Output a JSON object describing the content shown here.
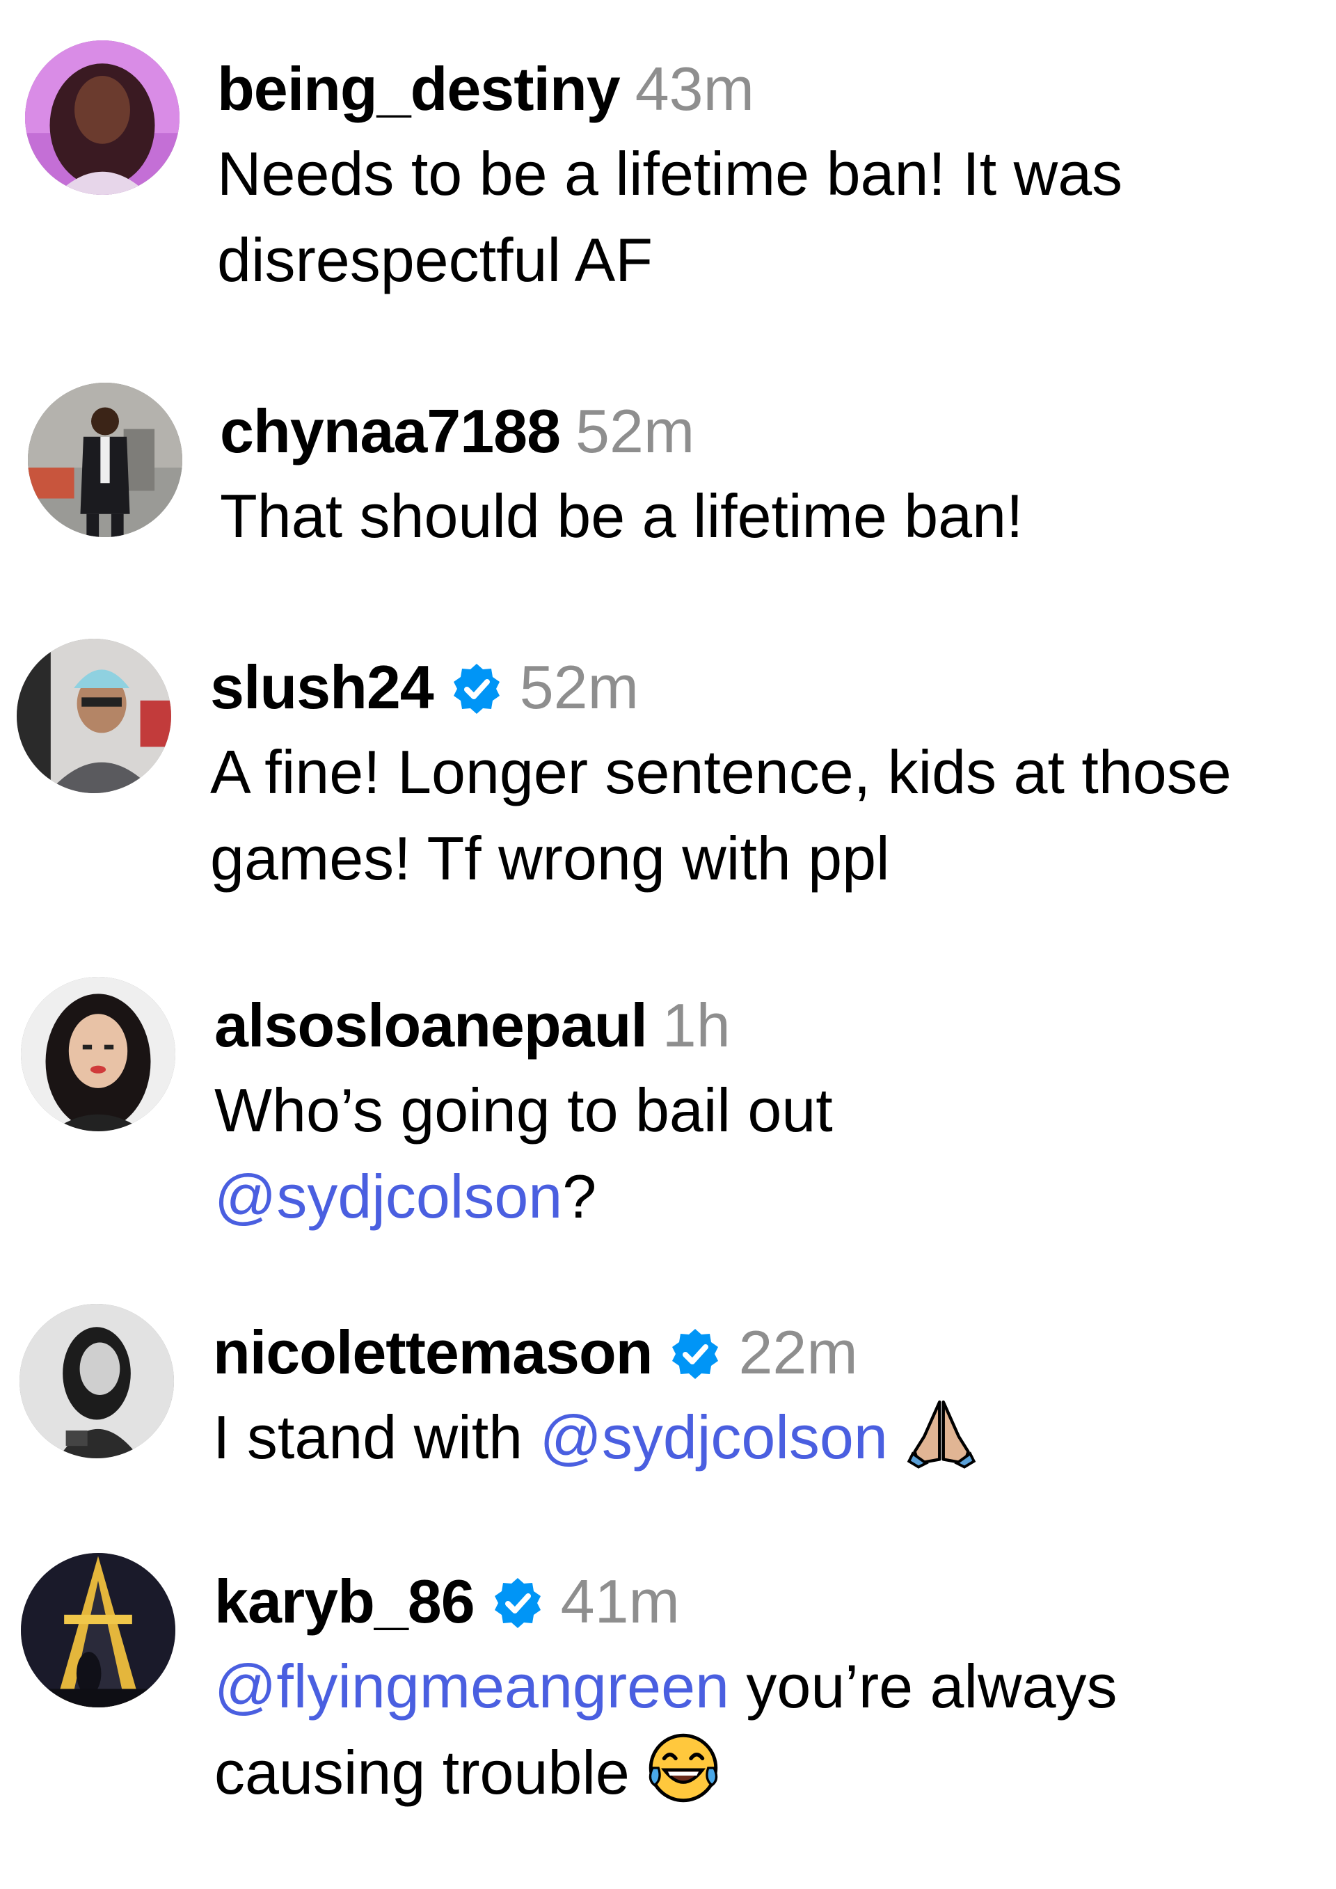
{
  "colors": {
    "username": "#000000",
    "timestamp": "#8e8e8e",
    "mention": "#4a5fe0",
    "verified_badge": "#0095f6"
  },
  "comments": [
    {
      "username": "being_destiny",
      "verified": false,
      "time": "43m",
      "lines": [
        [
          {
            "text": "Needs to be a lifetime ban! It was"
          }
        ],
        [
          {
            "text": "disrespectful AF"
          }
        ]
      ],
      "avatar_icon": "avatar-photo-woman-pink"
    },
    {
      "username": "chynaa7188",
      "verified": false,
      "time": "52m",
      "lines": [
        [
          {
            "text": "That should be a lifetime ban!"
          }
        ]
      ],
      "avatar_icon": "avatar-photo-man-suit"
    },
    {
      "username": "slush24",
      "verified": true,
      "time": "52m",
      "lines": [
        [
          {
            "text": "A fine! Longer sentence, kids at those"
          }
        ],
        [
          {
            "text": "games! Tf wrong with ppl"
          }
        ]
      ],
      "avatar_icon": "avatar-photo-man-beanie"
    },
    {
      "username": "alsosloanepaul",
      "verified": false,
      "time": "1h",
      "lines": [
        [
          {
            "text": "Who’s going to bail out"
          }
        ],
        [
          {
            "mention": "@sydjcolson"
          },
          {
            "text": "?"
          }
        ]
      ],
      "avatar_icon": "avatar-photo-woman-selfie"
    },
    {
      "username": "nicolettemason",
      "verified": true,
      "time": "22m",
      "lines": [
        [
          {
            "text": "I stand with "
          },
          {
            "mention": "@sydjcolson"
          },
          {
            "emoji": "folded-hands-emoji"
          }
        ]
      ],
      "avatar_icon": "avatar-photo-woman-bw"
    },
    {
      "username": "karyb_86",
      "verified": true,
      "time": "41m",
      "lines": [
        [
          {
            "mention": "@flyingmeangreen"
          },
          {
            "text": " you’re always"
          }
        ],
        [
          {
            "text": "causing trouble"
          },
          {
            "emoji": "tears-of-joy-emoji"
          }
        ]
      ],
      "avatar_icon": "avatar-photo-eiffel-tower-night"
    }
  ]
}
